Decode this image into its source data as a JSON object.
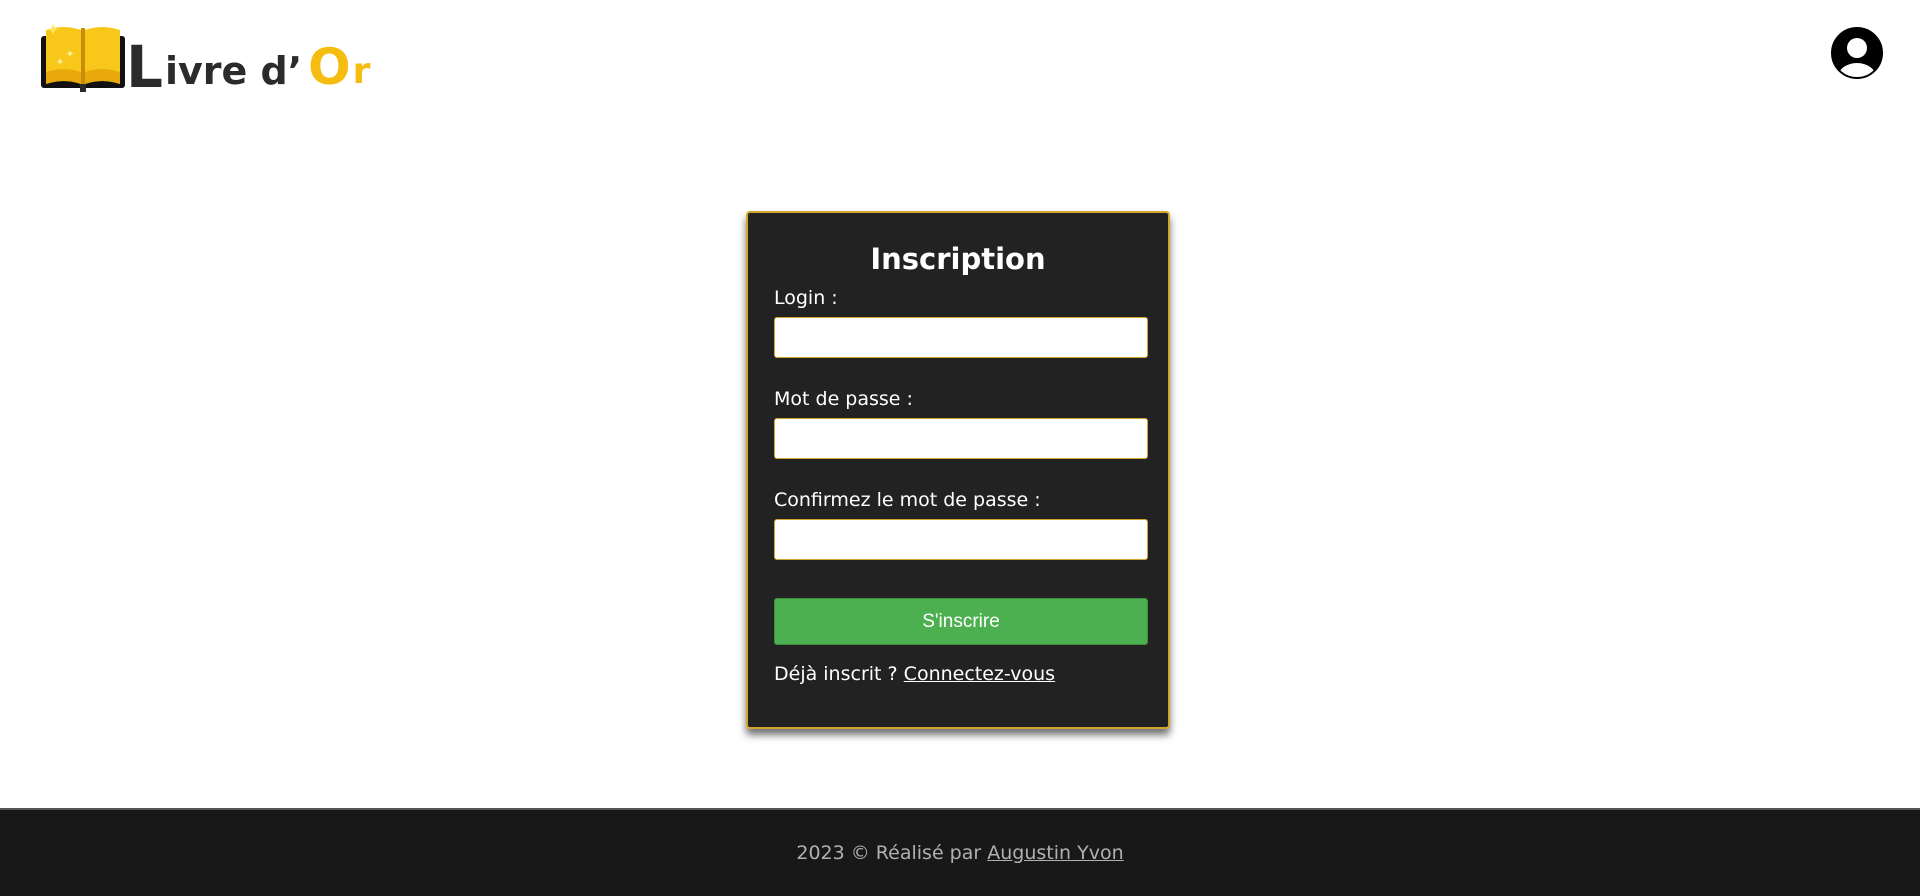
{
  "header": {
    "logo": {
      "text_L": "L",
      "text_rest": "ivre d’",
      "text_O": "O",
      "text_r": "r",
      "icon": "open-book-icon"
    },
    "user_icon": "user-avatar-icon"
  },
  "form": {
    "title": "Inscription",
    "login_label": "Login :",
    "login_value": "",
    "password_label": "Mot de passe :",
    "password_value": "",
    "confirm_label": "Confirmez le mot de passe :",
    "confirm_value": "",
    "submit_label": "S'inscrire",
    "already_text": "Déjà inscrit ?",
    "login_link": "Connectez-vous"
  },
  "footer": {
    "text": "2023 © Réalisé par",
    "author_link": "Augustin Yvon"
  },
  "colors": {
    "accent_gold": "#f5bd10",
    "card_bg": "#222222",
    "card_border": "#d4a72c",
    "submit_green": "#4caf50",
    "footer_bg": "#181818"
  }
}
